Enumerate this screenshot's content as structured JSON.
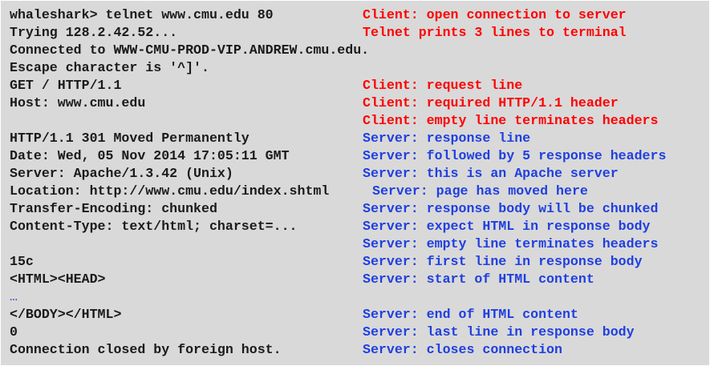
{
  "colors": {
    "background": "#d9d9d9",
    "command_text": "#1a1a1a",
    "client_annotation": "#ff0000",
    "server_annotation": "#1f3fe0"
  },
  "lines": [
    {
      "cmd": "whaleshark> telnet www.cmu.edu 80",
      "note": "Client: open connection to server",
      "who": "client"
    },
    {
      "cmd": "Trying 128.2.42.52...",
      "note": "Telnet prints 3 lines to terminal",
      "who": "client"
    },
    {
      "cmd": "Connected to WWW-CMU-PROD-VIP.ANDREW.cmu.edu.",
      "note": "",
      "who": ""
    },
    {
      "cmd": "Escape character is '^]'.",
      "note": "",
      "who": ""
    },
    {
      "cmd": "GET / HTTP/1.1",
      "note": "Client: request line",
      "who": "client"
    },
    {
      "cmd": "Host: www.cmu.edu",
      "note": "Client: required HTTP/1.1 header",
      "who": "client"
    },
    {
      "cmd": "",
      "note": "Client: empty line terminates headers",
      "who": "client"
    },
    {
      "cmd": "HTTP/1.1 301 Moved Permanently",
      "note": "Server: response line",
      "who": "server"
    },
    {
      "cmd": "Date: Wed, 05 Nov 2014 17:05:11 GMT",
      "note": "Server: followed by 5 response headers",
      "who": "server"
    },
    {
      "cmd": "Server: Apache/1.3.42 (Unix)",
      "note": "Server: this is an Apache server",
      "who": "server"
    },
    {
      "cmd": "Location: http://www.cmu.edu/index.shtml",
      "note": "Server: page has moved here",
      "who": "server"
    },
    {
      "cmd": "Transfer-Encoding: chunked",
      "note": "Server: response body will be chunked",
      "who": "server"
    },
    {
      "cmd": "Content-Type: text/html; charset=...",
      "note": "Server: expect HTML in response body",
      "who": "server"
    },
    {
      "cmd": "",
      "note": "Server: empty line terminates headers",
      "who": "server"
    },
    {
      "cmd": "15c",
      "note": "Server: first line in response body",
      "who": "server"
    },
    {
      "cmd": "<HTML><HEAD>",
      "note": "Server: start of HTML content",
      "who": "server"
    },
    {
      "cmd": "…",
      "note": "",
      "who": "ellipsis"
    },
    {
      "cmd": "</BODY></HTML>",
      "note": "Server: end of HTML content",
      "who": "server"
    },
    {
      "cmd": "0",
      "note": "Server: last line in response body",
      "who": "server"
    },
    {
      "cmd": "Connection closed by foreign host.",
      "note": "Server: closes connection",
      "who": "server"
    }
  ]
}
